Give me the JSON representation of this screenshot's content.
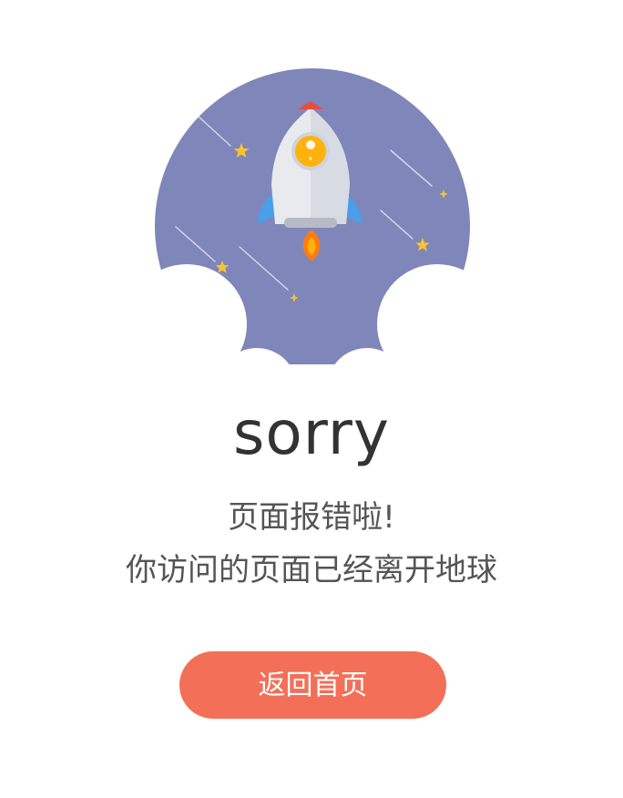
{
  "colors": {
    "circle": "#7f86b9",
    "button": "#f36f57",
    "star": "#f7c531",
    "rocket_body": "#e8eaee",
    "rocket_tip": "#e84c3d",
    "window": "#ffb20b",
    "fin": "#4a9eea",
    "flame": "#ff7a12"
  },
  "illustration": {
    "icons": [
      "rocket-icon",
      "star-icon",
      "cloud-icon"
    ]
  },
  "content": {
    "title": "sorry",
    "message_line1": "页面报错啦!",
    "message_line2": "你访问的页面已经离开地球"
  },
  "actions": {
    "back_home_label": "返回首页"
  }
}
